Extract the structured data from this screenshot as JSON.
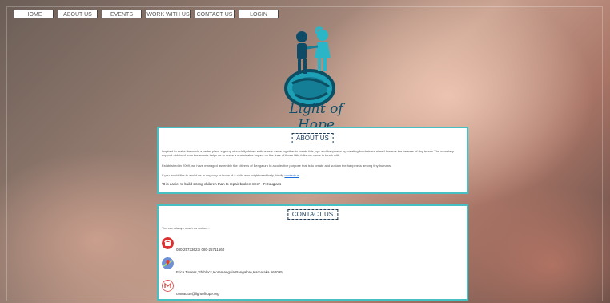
{
  "nav": {
    "items": [
      {
        "label": "HOME"
      },
      {
        "label": "ABOUT US"
      },
      {
        "label": "EVENTS"
      },
      {
        "label": "WORK WITH US"
      },
      {
        "label": "CONTACT US"
      },
      {
        "label": "LOGIN"
      }
    ]
  },
  "logo": {
    "text": "Light of Hope"
  },
  "about": {
    "title": "ABOUT US",
    "p1": "Inspired to make the world a better place a group of socially driven enthusiasts came together to create this joys and happiness by creating fundraisers aimed towards the bearers of tiny hearts.The monetary support obtained from the events helps us to make a sustainable impact on the lives of those little folks we come in touch with.",
    "p2": "Established in 2009, we have managed assemble the citizens of Bengaluru to a collective purpose that is to create and sustain the happiness among tiny humans.",
    "p3_text": "If you would like to assist us in any way or know of a child who might need help, kindly ",
    "p3_link": "contact us",
    "quote": "\"It is easier to build strong children than to repair broken men\" - F.Douglass"
  },
  "contact": {
    "title": "CONTACT US",
    "intro": "You can always reach us out on...",
    "phone": "080-25733623/ 080-25711660",
    "address": "Erica Towers,7th block,Koramangala,Bangalore,Karnataka 560095",
    "email": "contactus@lightofhope.org"
  },
  "colors": {
    "accent": "#47c0c3",
    "brand": "#0d4f6b"
  }
}
